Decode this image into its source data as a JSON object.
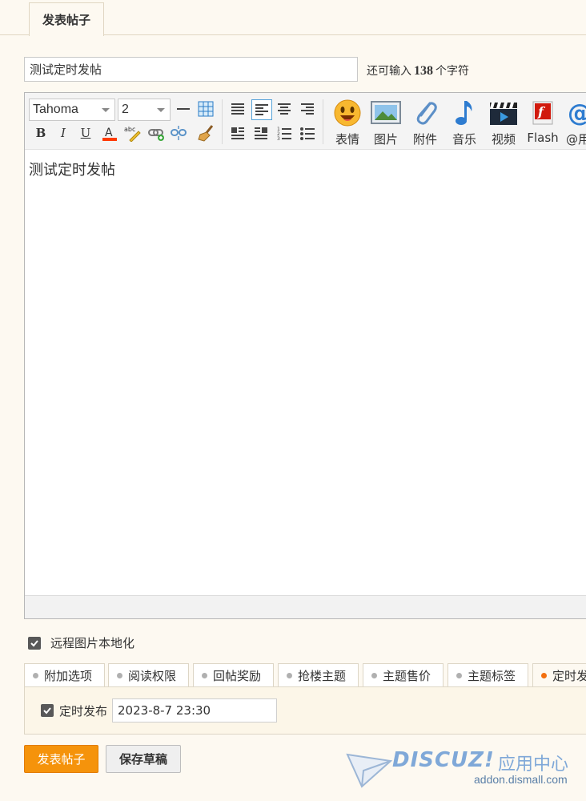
{
  "top_tab": {
    "label": "发表帖子"
  },
  "subject": {
    "value": "测试定时发帖",
    "hint_prefix": "还可输入",
    "remaining": "138",
    "hint_suffix": "个字符"
  },
  "toolbar": {
    "font": "Tahoma",
    "size": "2",
    "big_buttons": [
      {
        "label": "表情",
        "icon": "smiley-icon"
      },
      {
        "label": "图片",
        "icon": "image-icon"
      },
      {
        "label": "附件",
        "icon": "paperclip-icon"
      },
      {
        "label": "音乐",
        "icon": "music-note-icon"
      },
      {
        "label": "视频",
        "icon": "video-icon"
      },
      {
        "label": "Flash",
        "icon": "flash-icon"
      },
      {
        "label": "@用户",
        "icon": "at-icon"
      }
    ]
  },
  "editor": {
    "content": "测试定时发帖"
  },
  "remote_image": {
    "label": "远程图片本地化",
    "checked": true
  },
  "extra_tabs": [
    {
      "label": "附加选项",
      "active": false
    },
    {
      "label": "阅读权限",
      "active": false
    },
    {
      "label": "回帖奖励",
      "active": false
    },
    {
      "label": "抢楼主题",
      "active": false
    },
    {
      "label": "主题售价",
      "active": false
    },
    {
      "label": "主题标签",
      "active": false
    },
    {
      "label": "定时发布",
      "active": true
    }
  ],
  "schedule": {
    "label": "定时发布",
    "checked": true,
    "value": "2023-8-7 23:30"
  },
  "buttons": {
    "submit": "发表帖子",
    "draft": "保存草稿"
  },
  "watermark": {
    "brand": "DISCUZ!",
    "cn": "应用中心",
    "url": "addon.dismall.com"
  },
  "colors": {
    "accent": "#f5930b",
    "active_dot": "#f36f0e",
    "watermark": "#7fa8d8"
  }
}
